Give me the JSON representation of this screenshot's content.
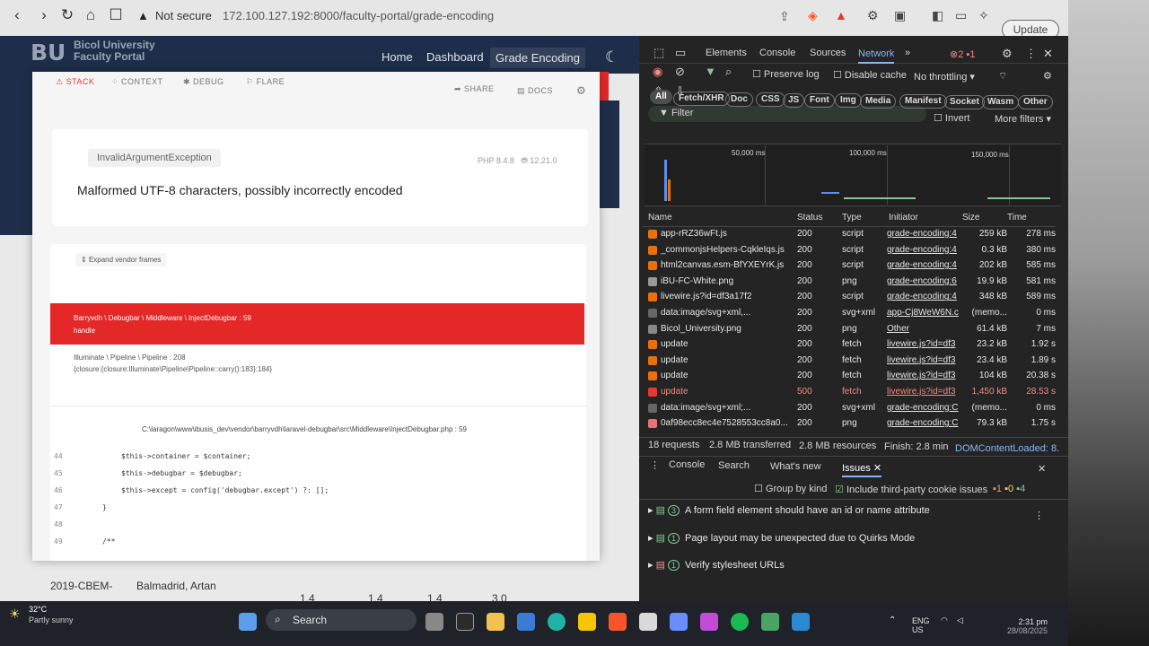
{
  "browser": {
    "warning": "Not secure",
    "url": "172.100.127.192:8000/faculty-portal/grade-encoding",
    "update_label": "Update"
  },
  "header": {
    "logo": "BU",
    "logo_line1": "Bicol University",
    "logo_line2": "Faculty Portal",
    "nav": [
      "Home",
      "Dashboard",
      "Grade Encoding"
    ]
  },
  "ignition": {
    "tabs": [
      "STACK",
      "CONTEXT",
      "DEBUG",
      "FLARE"
    ],
    "share": "SHARE",
    "docs": "DOCS",
    "exception_type": "InvalidArgumentException",
    "php_version": "PHP 8.4.8",
    "laravel_version": "12.21.0",
    "message": "Malformed UTF-8 characters, possibly incorrectly encoded",
    "expand_vendor": "Expand vendor frames",
    "frame_active": "Barryvdh \\ Debugbar \\ Middleware \\ InjectDebugbar : 59",
    "frame_active_fn": "handle",
    "frame2": "Illuminate \\ Pipeline \\ Pipeline : 208",
    "frame2_fn": "{closure:{closure:Illuminate\\Pipeline\\Pipeline::carry():183}:184}",
    "code_path": "C:\\laragon\\www\\ibusis_dev\\vendor\\barryvdh\\laravel-debugbar\\src\\Middleware\\InjectDebugbar.php : 59",
    "code_lines": [
      {
        "n": "44",
        "t": "$this->container = $container;"
      },
      {
        "n": "45",
        "t": "$this->debugbar = $debugbar;"
      },
      {
        "n": "46",
        "t": "$this->except = config('debugbar.except') ?: [];"
      },
      {
        "n": "47",
        "t": "}"
      },
      {
        "n": "48",
        "t": ""
      },
      {
        "n": "49",
        "t": "/**"
      }
    ]
  },
  "behind_row": {
    "code": "2019-CBEM-",
    "name": "Balmadrid, Artan",
    "g1": "1.4",
    "g2": "1.4",
    "g3": "1.4",
    "g4": "3.0"
  },
  "devtools": {
    "tabs": [
      "Elements",
      "Console",
      "Sources",
      "Network"
    ],
    "err_count": "2",
    "warn_count": "1",
    "preserve_log": "Preserve log",
    "disable_cache": "Disable cache",
    "throttling": "No throttling",
    "filter": "Filter",
    "invert": "Invert",
    "more_filters": "More filters",
    "chips": [
      "All",
      "Fetch/XHR",
      "Doc",
      "CSS",
      "JS",
      "Font",
      "Img",
      "Media",
      "Manifest",
      "Socket",
      "Wasm",
      "Other"
    ],
    "timeline_ticks": [
      "50,000 ms",
      "100,000 ms",
      "150,000 ms"
    ],
    "columns": [
      "Name",
      "Status",
      "Type",
      "Initiator",
      "Size",
      "Time"
    ],
    "rows": [
      {
        "name": "app-rRZ36wFt.js",
        "status": "200",
        "type": "script",
        "init": "grade-encoding:4",
        "size": "259 kB",
        "time": "278 ms",
        "icon": "#e8710a"
      },
      {
        "name": "_commonjsHelpers-CqkleIqs.js",
        "status": "200",
        "type": "script",
        "init": "grade-encoding:4",
        "size": "0.3 kB",
        "time": "380 ms",
        "icon": "#e8710a"
      },
      {
        "name": "html2canvas.esm-BfYXEYrK.js",
        "status": "200",
        "type": "script",
        "init": "grade-encoding:4",
        "size": "202 kB",
        "time": "585 ms",
        "icon": "#e8710a"
      },
      {
        "name": "iBU-FC-White.png",
        "status": "200",
        "type": "png",
        "init": "grade-encoding:6",
        "size": "19.9 kB",
        "time": "581 ms",
        "icon": "#999"
      },
      {
        "name": "livewire.js?id=df3a17f2",
        "status": "200",
        "type": "script",
        "init": "grade-encoding:4",
        "size": "348 kB",
        "time": "589 ms",
        "icon": "#e8710a"
      },
      {
        "name": "data:image/svg+xml,...",
        "status": "200",
        "type": "svg+xml",
        "init": "app-Cj8WeW6N.c",
        "size": "(memo...",
        "time": "0 ms",
        "icon": "#666"
      },
      {
        "name": "Bicol_University.png",
        "status": "200",
        "type": "png",
        "init": "Other",
        "size": "61.4 kB",
        "time": "7 ms",
        "icon": "#888"
      },
      {
        "name": "update",
        "status": "200",
        "type": "fetch",
        "init": "livewire.js?id=df3",
        "size": "23.2 kB",
        "time": "1.92 s",
        "icon": "#e8710a"
      },
      {
        "name": "update",
        "status": "200",
        "type": "fetch",
        "init": "livewire.js?id=df3",
        "size": "23.4 kB",
        "time": "1.89 s",
        "icon": "#e8710a"
      },
      {
        "name": "update",
        "status": "200",
        "type": "fetch",
        "init": "livewire.js?id=df3",
        "size": "104 kB",
        "time": "20.38 s",
        "icon": "#e8710a"
      },
      {
        "name": "update",
        "status": "500",
        "type": "fetch",
        "init": "livewire.js?id=df3",
        "size": "1,450 kB",
        "time": "28.53 s",
        "icon": "#e53935",
        "err": true
      },
      {
        "name": "data:image/svg+xml;...",
        "status": "200",
        "type": "svg+xml",
        "init": "grade-encoding:C",
        "size": "(memo...",
        "time": "0 ms",
        "icon": "#666"
      },
      {
        "name": "0af98ecc8ec4e7528553cc8a0...",
        "status": "200",
        "type": "png",
        "init": "grade-encoding:C",
        "size": "79.3 kB",
        "time": "1.75 s",
        "icon": "#e57373"
      }
    ],
    "summary": [
      "18 requests",
      "2.8 MB transferred",
      "2.8 MB resources",
      "Finish: 2.8 min",
      "DOMContentLoaded: 8.1"
    ],
    "drawer_tabs": [
      "Console",
      "Search",
      "What's new",
      "Issues"
    ],
    "group_by_kind": "Group by kind",
    "third_party": "Include third-party cookie issues",
    "issue_counts": [
      "1",
      "0",
      "4"
    ],
    "issues": [
      {
        "count": "3",
        "text": "A form field element should have an id or name attribute"
      },
      {
        "count": "1",
        "text": "Page layout may be unexpected due to Quirks Mode"
      },
      {
        "count": "1",
        "text": "Verify stylesheet URLs"
      }
    ]
  },
  "taskbar": {
    "temp": "32°C",
    "weather": "Partly sunny",
    "search": "Search",
    "lang": "ENG",
    "region": "US",
    "time": "2:31 pm",
    "date": "28/08/2025"
  }
}
